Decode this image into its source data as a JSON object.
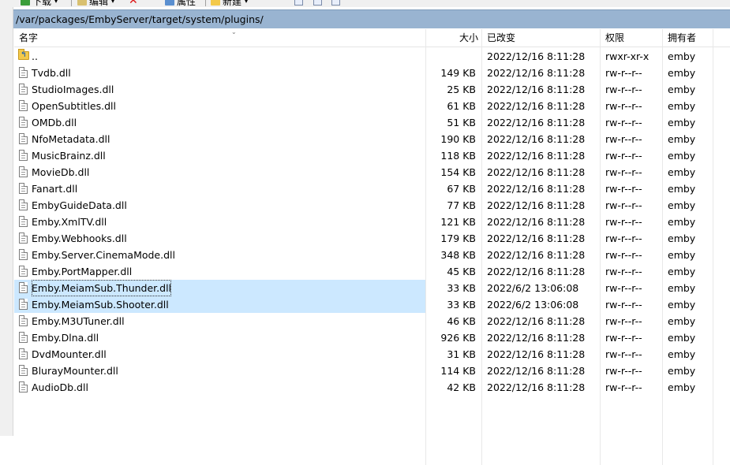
{
  "toolbar": {
    "download_label": "下载",
    "edit_label": "编辑",
    "properties_label": "属性",
    "new_label": "新建"
  },
  "path": "/var/packages/EmbyServer/target/system/plugins/",
  "columns": {
    "name": "名字",
    "size": "大小",
    "modified": "已改变",
    "permissions": "权限",
    "owner": "拥有者"
  },
  "colors": {
    "selected_row": "#cce8ff",
    "path_bar": "#99b4d1"
  },
  "files": [
    {
      "name": "..",
      "size": "",
      "modified": "2022/12/16 8:11:28",
      "perm": "rwxr-xr-x",
      "owner": "emby",
      "icon": "parent-folder-icon"
    },
    {
      "name": "Tvdb.dll",
      "size": "149 KB",
      "modified": "2022/12/16 8:11:28",
      "perm": "rw-r--r--",
      "owner": "emby",
      "icon": "file-icon"
    },
    {
      "name": "StudioImages.dll",
      "size": "25 KB",
      "modified": "2022/12/16 8:11:28",
      "perm": "rw-r--r--",
      "owner": "emby",
      "icon": "file-icon"
    },
    {
      "name": "OpenSubtitles.dll",
      "size": "61 KB",
      "modified": "2022/12/16 8:11:28",
      "perm": "rw-r--r--",
      "owner": "emby",
      "icon": "file-icon"
    },
    {
      "name": "OMDb.dll",
      "size": "51 KB",
      "modified": "2022/12/16 8:11:28",
      "perm": "rw-r--r--",
      "owner": "emby",
      "icon": "file-icon"
    },
    {
      "name": "NfoMetadata.dll",
      "size": "190 KB",
      "modified": "2022/12/16 8:11:28",
      "perm": "rw-r--r--",
      "owner": "emby",
      "icon": "file-icon"
    },
    {
      "name": "MusicBrainz.dll",
      "size": "118 KB",
      "modified": "2022/12/16 8:11:28",
      "perm": "rw-r--r--",
      "owner": "emby",
      "icon": "file-icon"
    },
    {
      "name": "MovieDb.dll",
      "size": "154 KB",
      "modified": "2022/12/16 8:11:28",
      "perm": "rw-r--r--",
      "owner": "emby",
      "icon": "file-icon"
    },
    {
      "name": "Fanart.dll",
      "size": "67 KB",
      "modified": "2022/12/16 8:11:28",
      "perm": "rw-r--r--",
      "owner": "emby",
      "icon": "file-icon"
    },
    {
      "name": "EmbyGuideData.dll",
      "size": "77 KB",
      "modified": "2022/12/16 8:11:28",
      "perm": "rw-r--r--",
      "owner": "emby",
      "icon": "file-icon"
    },
    {
      "name": "Emby.XmlTV.dll",
      "size": "121 KB",
      "modified": "2022/12/16 8:11:28",
      "perm": "rw-r--r--",
      "owner": "emby",
      "icon": "file-icon"
    },
    {
      "name": "Emby.Webhooks.dll",
      "size": "179 KB",
      "modified": "2022/12/16 8:11:28",
      "perm": "rw-r--r--",
      "owner": "emby",
      "icon": "file-icon"
    },
    {
      "name": "Emby.Server.CinemaMode.dll",
      "size": "348 KB",
      "modified": "2022/12/16 8:11:28",
      "perm": "rw-r--r--",
      "owner": "emby",
      "icon": "file-icon"
    },
    {
      "name": "Emby.PortMapper.dll",
      "size": "45 KB",
      "modified": "2022/12/16 8:11:28",
      "perm": "rw-r--r--",
      "owner": "emby",
      "icon": "file-icon"
    },
    {
      "name": "Emby.MeiamSub.Thunder.dll",
      "size": "33 KB",
      "modified": "2022/6/2 13:06:08",
      "perm": "rw-r--r--",
      "owner": "emby",
      "icon": "file-icon",
      "selected": true,
      "focused": true
    },
    {
      "name": "Emby.MeiamSub.Shooter.dll",
      "size": "33 KB",
      "modified": "2022/6/2 13:06:08",
      "perm": "rw-r--r--",
      "owner": "emby",
      "icon": "file-icon",
      "selected": true
    },
    {
      "name": "Emby.M3UTuner.dll",
      "size": "46 KB",
      "modified": "2022/12/16 8:11:28",
      "perm": "rw-r--r--",
      "owner": "emby",
      "icon": "file-icon"
    },
    {
      "name": "Emby.Dlna.dll",
      "size": "926 KB",
      "modified": "2022/12/16 8:11:28",
      "perm": "rw-r--r--",
      "owner": "emby",
      "icon": "file-icon"
    },
    {
      "name": "DvdMounter.dll",
      "size": "31 KB",
      "modified": "2022/12/16 8:11:28",
      "perm": "rw-r--r--",
      "owner": "emby",
      "icon": "file-icon"
    },
    {
      "name": "BlurayMounter.dll",
      "size": "114 KB",
      "modified": "2022/12/16 8:11:28",
      "perm": "rw-r--r--",
      "owner": "emby",
      "icon": "file-icon"
    },
    {
      "name": "AudioDb.dll",
      "size": "42 KB",
      "modified": "2022/12/16 8:11:28",
      "perm": "rw-r--r--",
      "owner": "emby",
      "icon": "file-icon"
    }
  ]
}
